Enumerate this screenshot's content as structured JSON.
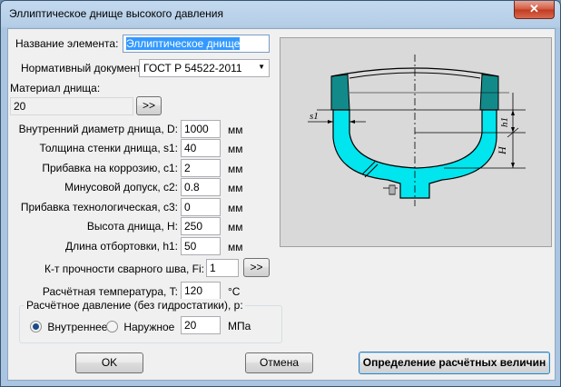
{
  "window": {
    "title": "Эллиптическое днище высокого давления",
    "close": "✕"
  },
  "element_name": {
    "label": "Название элемента:",
    "value": "Эллиптическое днище"
  },
  "norm_doc": {
    "label": "Нормативный документ:",
    "value": "ГОСТ Р 54522-2011"
  },
  "material": {
    "label": "Материал днища:",
    "value": "20",
    "button": ">>"
  },
  "fields": [
    {
      "label": "Внутренний диаметр днища, D:",
      "value": "1000",
      "unit": "мм"
    },
    {
      "label": "Толщина стенки днища, s1:",
      "value": "40",
      "unit": "мм"
    },
    {
      "label": "Прибавка на коррозию, c1:",
      "value": "2",
      "unit": "мм"
    },
    {
      "label": "Минусовой допуск, c2:",
      "value": "0.8",
      "unit": "мм"
    },
    {
      "label": "Прибавка технологическая, c3:",
      "value": "0",
      "unit": "мм"
    },
    {
      "label": "Высота днища, H:",
      "value": "250",
      "unit": "мм"
    },
    {
      "label": "Длина отбортовки, h1:",
      "value": "50",
      "unit": "мм"
    }
  ],
  "weld": {
    "label": "К-т прочности сварного шва, Fi:",
    "value": "1",
    "button": ">>"
  },
  "temperature": {
    "label": "Расчётная температура, T:",
    "value": "120",
    "unit": "°C"
  },
  "pressure": {
    "group_label": "Расчётное давление (без гидростатики), p:",
    "inner": "Внутреннее",
    "outer": "Наружное",
    "value": "20",
    "unit": "МПа"
  },
  "buttons": {
    "ok": "OK",
    "cancel": "Отмена",
    "calc": "Определение расчётных величин"
  },
  "drawing": {
    "s1": "s1",
    "h1": "h1",
    "H": "H"
  },
  "colors": {
    "cyan": "#00e5ee",
    "teal": "#138a8a",
    "picture_bg": "#d9d9d9"
  }
}
